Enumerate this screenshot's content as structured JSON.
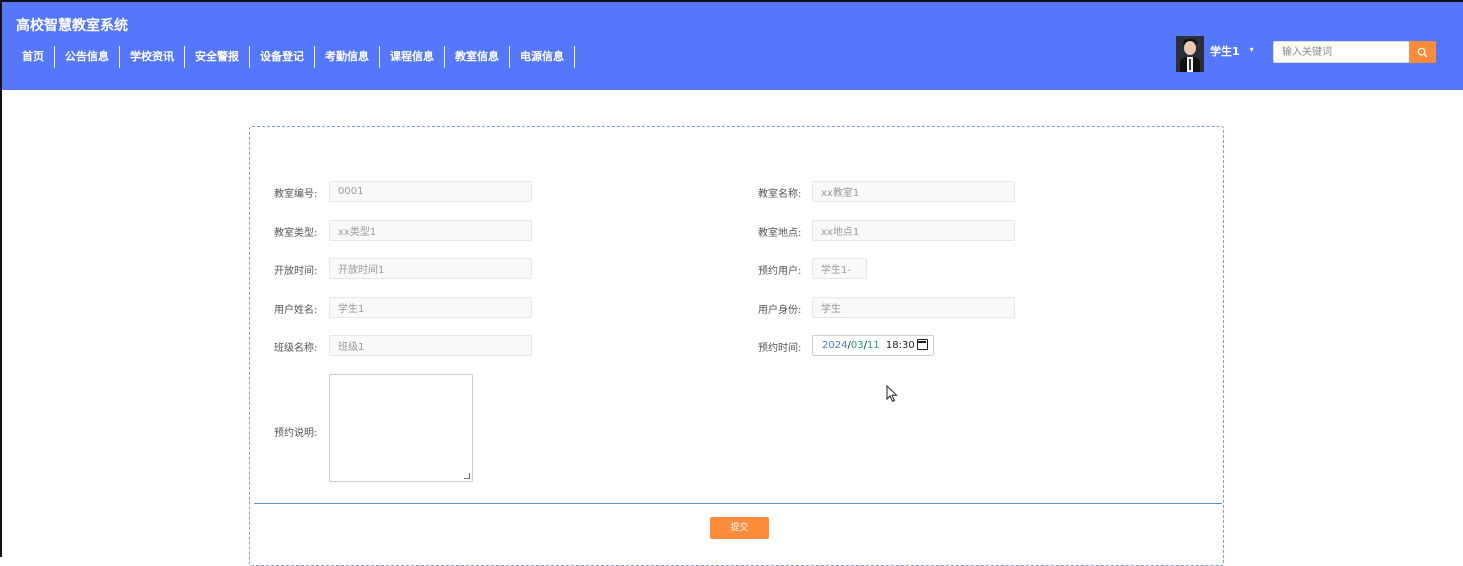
{
  "header": {
    "title": "高校智慧教室系统",
    "nav": [
      "首页",
      "公告信息",
      "学校资讯",
      "安全警报",
      "设备登记",
      "考勤信息",
      "课程信息",
      "教室信息",
      "电源信息"
    ],
    "user": {
      "name": "学生1",
      "caret": "▾"
    },
    "search": {
      "placeholder": "输入关键词",
      "icon": "search-icon"
    },
    "colors": {
      "header_bg": "#5577fc",
      "accent": "#fb8c3c"
    }
  },
  "form": {
    "classroom_no": {
      "label": "教室编号:",
      "value": "0001"
    },
    "classroom_name": {
      "label": "教室名称:",
      "value": "xx教室1"
    },
    "classroom_type": {
      "label": "教室类型:",
      "value": "xx类型1"
    },
    "classroom_location": {
      "label": "教室地点:",
      "value": "xx地点1"
    },
    "open_time": {
      "label": "开放时间:",
      "value": "开放时间1"
    },
    "booking_user": {
      "label": "预约用户:",
      "value": "学生1-"
    },
    "user_name": {
      "label": "用户姓名:",
      "value": "学生1"
    },
    "user_role": {
      "label": "用户身份:",
      "value": "学生"
    },
    "class_name": {
      "label": "班级名称:",
      "value": "班级1"
    },
    "booking_time": {
      "label": "预约时间:",
      "year": "2024",
      "sep1": "/",
      "month": "03",
      "sep2": "/",
      "day": "11",
      "time": "18:30",
      "icon": "calendar-icon"
    },
    "booking_note": {
      "label": "预约说明:",
      "value": ""
    },
    "submit_label": "提交"
  }
}
